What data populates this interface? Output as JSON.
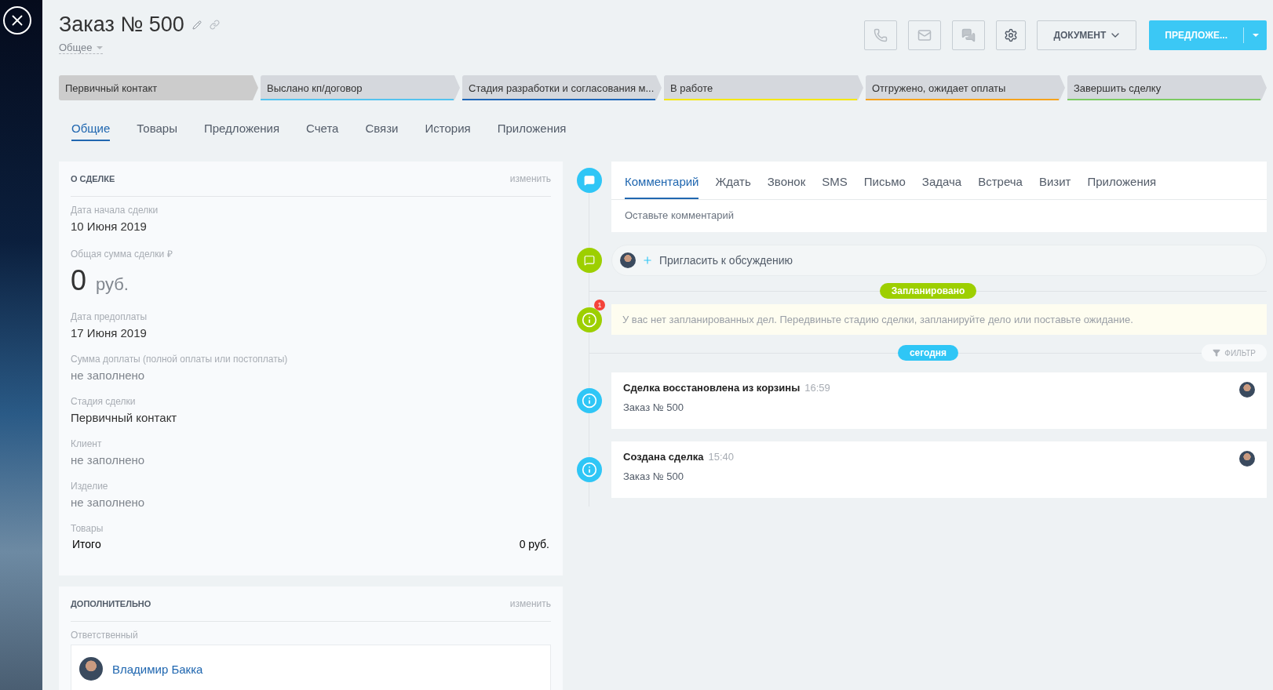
{
  "title": "Заказ № 500",
  "category": "Общее",
  "toolbar": {
    "document_button": "ДОКУМЕНТ",
    "primary_button": "ПРЕДЛОЖЕ..."
  },
  "stages": [
    {
      "label": "Первичный контакт",
      "selected": true
    },
    {
      "label": "Выслано кп/договор",
      "selected": false,
      "color": "#55c3ef"
    },
    {
      "label": "Стадия разработки и согласования м...",
      "selected": false,
      "color": "#1f67b8"
    },
    {
      "label": "В работе",
      "selected": false,
      "color": "#f5e800"
    },
    {
      "label": "Отгружено, ожидает оплаты",
      "selected": false,
      "color": "#f6a31c"
    },
    {
      "label": "Завершить сделку",
      "selected": false,
      "color": "#7ccb62"
    }
  ],
  "tabs": [
    {
      "label": "Общие",
      "selected": true
    },
    {
      "label": "Товары",
      "selected": false
    },
    {
      "label": "Предложения",
      "selected": false
    },
    {
      "label": "Счета",
      "selected": false
    },
    {
      "label": "Связи",
      "selected": false
    },
    {
      "label": "История",
      "selected": false
    },
    {
      "label": "Приложения",
      "selected": false
    }
  ],
  "deal_card": {
    "title": "О СДЕЛКЕ",
    "edit": "изменить",
    "fields": [
      {
        "kind": "value",
        "label": "Дата начала сделки",
        "value": "10 Июня 2019"
      },
      {
        "kind": "amount",
        "label": "Общая сумма сделки ₽",
        "value": "0",
        "unit": "руб."
      },
      {
        "kind": "value",
        "label": "Дата предоплаты",
        "value": "17 Июня 2019"
      },
      {
        "kind": "empty",
        "label": "Сумма доплаты (полной оплаты или постоплаты)",
        "value": "не заполнено"
      },
      {
        "kind": "value",
        "label": "Стадия сделки",
        "value": "Первичный контакт"
      },
      {
        "kind": "empty",
        "label": "Клиент",
        "value": "не заполнено"
      },
      {
        "kind": "empty",
        "label": "Изделие",
        "value": "не заполнено"
      },
      {
        "kind": "total",
        "label": "Товары",
        "value": "Итого",
        "unit": "0 руб."
      }
    ]
  },
  "extra_card": {
    "title": "ДОПОЛНИТЕЛЬНО",
    "edit": "изменить",
    "responsible_label": "Ответственный",
    "responsible": "Владимир Бакка"
  },
  "timeline": {
    "composer": {
      "tabs": [
        {
          "label": "Комментарий",
          "selected": true
        },
        {
          "label": "Ждать",
          "selected": false
        },
        {
          "label": "Звонок",
          "selected": false
        },
        {
          "label": "SMS",
          "selected": false
        },
        {
          "label": "Письмо",
          "selected": false
        },
        {
          "label": "Задача",
          "selected": false
        },
        {
          "label": "Встреча",
          "selected": false
        },
        {
          "label": "Визит",
          "selected": false
        },
        {
          "label": "Приложения",
          "selected": false
        }
      ],
      "placeholder": "Оставьте комментарий"
    },
    "invite": "Пригласить к обсуждению",
    "planned_label": "Запланировано",
    "notice": {
      "badge": "1",
      "text": "У вас нет запланированных дел. Передвиньте стадию сделки, запланируйте дело или поставьте ожидание."
    },
    "today_label": "сегодня",
    "filter": "ФИЛЬТР",
    "events": [
      {
        "title": "Сделка восстановлена из корзины",
        "time": "16:59",
        "subtitle": "Заказ № 500"
      },
      {
        "title": "Создана сделка",
        "time": "15:40",
        "subtitle": "Заказ № 500"
      }
    ]
  }
}
